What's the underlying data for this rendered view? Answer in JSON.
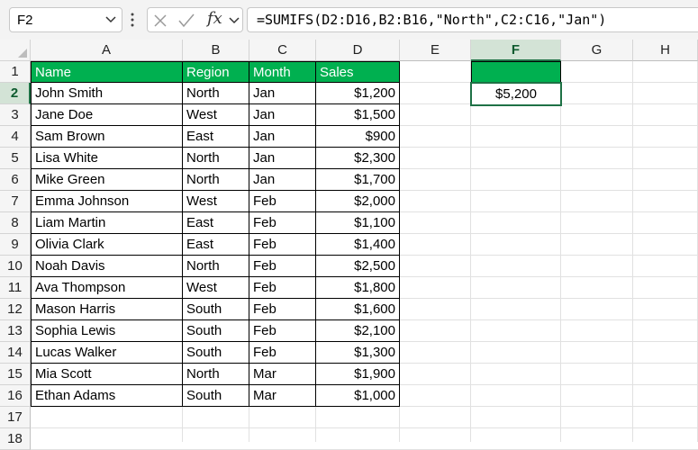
{
  "name_box": {
    "value": "F2"
  },
  "formula_bar": {
    "formula": "=SUMIFS(D2:D16,B2:B16,\"North\",C2:C16,\"Jan\")"
  },
  "columns": [
    "A",
    "B",
    "C",
    "D",
    "E",
    "F",
    "G",
    "H"
  ],
  "selected_column": "F",
  "rows": [
    "1",
    "2",
    "3",
    "4",
    "5",
    "6",
    "7",
    "8",
    "9",
    "10",
    "11",
    "12",
    "13",
    "14",
    "15",
    "16",
    "17",
    "18"
  ],
  "selected_row": "2",
  "table": {
    "headers": [
      "Name",
      "Region",
      "Month",
      "Sales"
    ],
    "rows": [
      [
        "John Smith",
        "North",
        "Jan",
        "$1,200"
      ],
      [
        "Jane Doe",
        "West",
        "Jan",
        "$1,500"
      ],
      [
        "Sam Brown",
        "East",
        "Jan",
        "$900"
      ],
      [
        "Lisa White",
        "North",
        "Jan",
        "$2,300"
      ],
      [
        "Mike Green",
        "North",
        "Jan",
        "$1,700"
      ],
      [
        "Emma Johnson",
        "West",
        "Feb",
        "$2,000"
      ],
      [
        "Liam Martin",
        "East",
        "Feb",
        "$1,100"
      ],
      [
        "Olivia Clark",
        "East",
        "Feb",
        "$1,400"
      ],
      [
        "Noah Davis",
        "North",
        "Feb",
        "$2,500"
      ],
      [
        "Ava Thompson",
        "West",
        "Feb",
        "$1,800"
      ],
      [
        "Mason Harris",
        "South",
        "Feb",
        "$1,600"
      ],
      [
        "Sophia Lewis",
        "South",
        "Feb",
        "$2,100"
      ],
      [
        "Lucas Walker",
        "South",
        "Feb",
        "$1,300"
      ],
      [
        "Mia Scott",
        "North",
        "Mar",
        "$1,900"
      ],
      [
        "Ethan Adams",
        "South",
        "Mar",
        "$1,000"
      ]
    ]
  },
  "result": {
    "header": "",
    "value": "$5,200"
  },
  "colors": {
    "header_fill": "#00b050",
    "selection": "#1e7145",
    "gridline": "#e1e1e1"
  },
  "icons": [
    "chevron-down-icon",
    "more-icon",
    "cancel-icon",
    "enter-icon",
    "insert-function-icon"
  ]
}
